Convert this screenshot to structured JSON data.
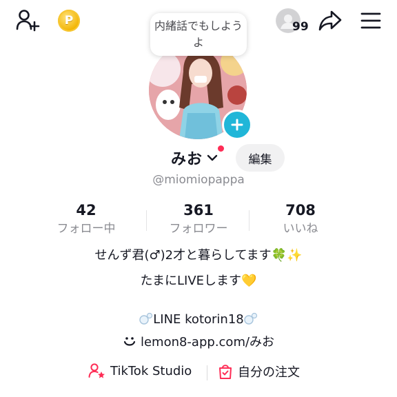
{
  "top_bar": {
    "coin_symbol": "P",
    "visitor_count": "99",
    "icons": [
      "add-friend-icon",
      "coin-icon",
      "visitor-icon",
      "share-icon",
      "menu-icon"
    ]
  },
  "note_bubble": {
    "text": "内緒話でもしようよ"
  },
  "profile": {
    "name": "みお",
    "edit_label": "編集",
    "handle": "@miomiopappa"
  },
  "stats": [
    {
      "value": "42",
      "label": "フォロー中"
    },
    {
      "value": "361",
      "label": "フォロワー"
    },
    {
      "value": "708",
      "label": "いいね"
    }
  ],
  "bio": {
    "line1": "せんず君(♂)2才と暮らしてます🍀✨",
    "line2": "たまにLIVEします💛"
  },
  "links": {
    "line_text": "LINE kotorin18",
    "lemon8_text": "lemon8-app.com/みお"
  },
  "bottom": {
    "studio_label": "TikTok Studio",
    "orders_label": "自分の注文"
  },
  "colors": {
    "accent_plus": "#20b6d8",
    "notification_dot": "#fe2c55",
    "secondary_text": "#8a8b91"
  }
}
